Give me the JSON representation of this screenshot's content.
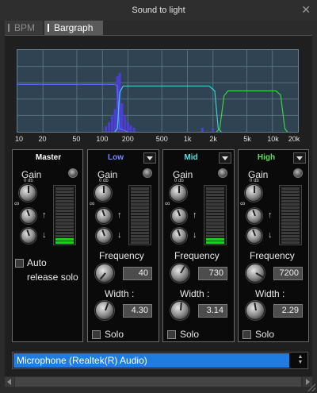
{
  "window": {
    "title": "Sound to light"
  },
  "tabs": [
    {
      "label": "BPM",
      "active": false
    },
    {
      "label": "Bargraph",
      "active": true
    }
  ],
  "spectrum": {
    "freq_labels": [
      "10",
      "20",
      "50",
      "100",
      "200",
      "500",
      "1k",
      "2k",
      "5k",
      "10k",
      "20k"
    ],
    "bars": [
      {
        "freq": 110,
        "level": 0.07
      },
      {
        "freq": 120,
        "level": 0.12
      },
      {
        "freq": 130,
        "level": 0.2
      },
      {
        "freq": 140,
        "level": 0.28
      },
      {
        "freq": 150,
        "level": 0.68
      },
      {
        "freq": 160,
        "level": 0.72
      },
      {
        "freq": 170,
        "level": 0.35
      },
      {
        "freq": 185,
        "level": 0.2
      },
      {
        "freq": 200,
        "level": 0.12
      },
      {
        "freq": 215,
        "level": 0.08
      },
      {
        "freq": 235,
        "level": 0.05
      },
      {
        "freq": 1500,
        "level": 0.05
      },
      {
        "freq": 2000,
        "level": 0.04
      }
    ],
    "colors": {
      "low": "#5a6cff",
      "mid": "#3fd0d0",
      "high": "#3fd04a",
      "bars": "#4a3fd0"
    }
  },
  "device": {
    "selected": "Microphone (Realtek(R) Audio)"
  },
  "bands": {
    "master": {
      "title": "Master",
      "gain_label": "Gain",
      "db": "0 db",
      "meter_level": 0.1,
      "auto_release_solo": "Auto release solo",
      "auto_line1": "Auto",
      "auto_line2": "release solo"
    },
    "low": {
      "title": "Low",
      "gain_label": "Gain",
      "db": "0 db",
      "meter_level": 0.0,
      "frequency_label": "Frequency",
      "frequency": "40",
      "width_label": "Width :",
      "width": "4.30",
      "solo_label": "Solo"
    },
    "mid": {
      "title": "Mid",
      "gain_label": "Gain",
      "db": "0 db",
      "meter_level": 0.1,
      "frequency_label": "Frequency",
      "frequency": "730",
      "width_label": "Width :",
      "width": "3.14",
      "solo_label": "Solo"
    },
    "high": {
      "title": "High",
      "gain_label": "Gain",
      "db": "0 db",
      "meter_level": 0.0,
      "frequency_label": "Frequency",
      "frequency": "7200",
      "width_label": "Width :",
      "width": "2.29",
      "solo_label": "Solo"
    }
  },
  "icons": {
    "close": "close-icon",
    "infinity": "∞",
    "up_arrow": "↑",
    "down_arrow": "↓"
  }
}
